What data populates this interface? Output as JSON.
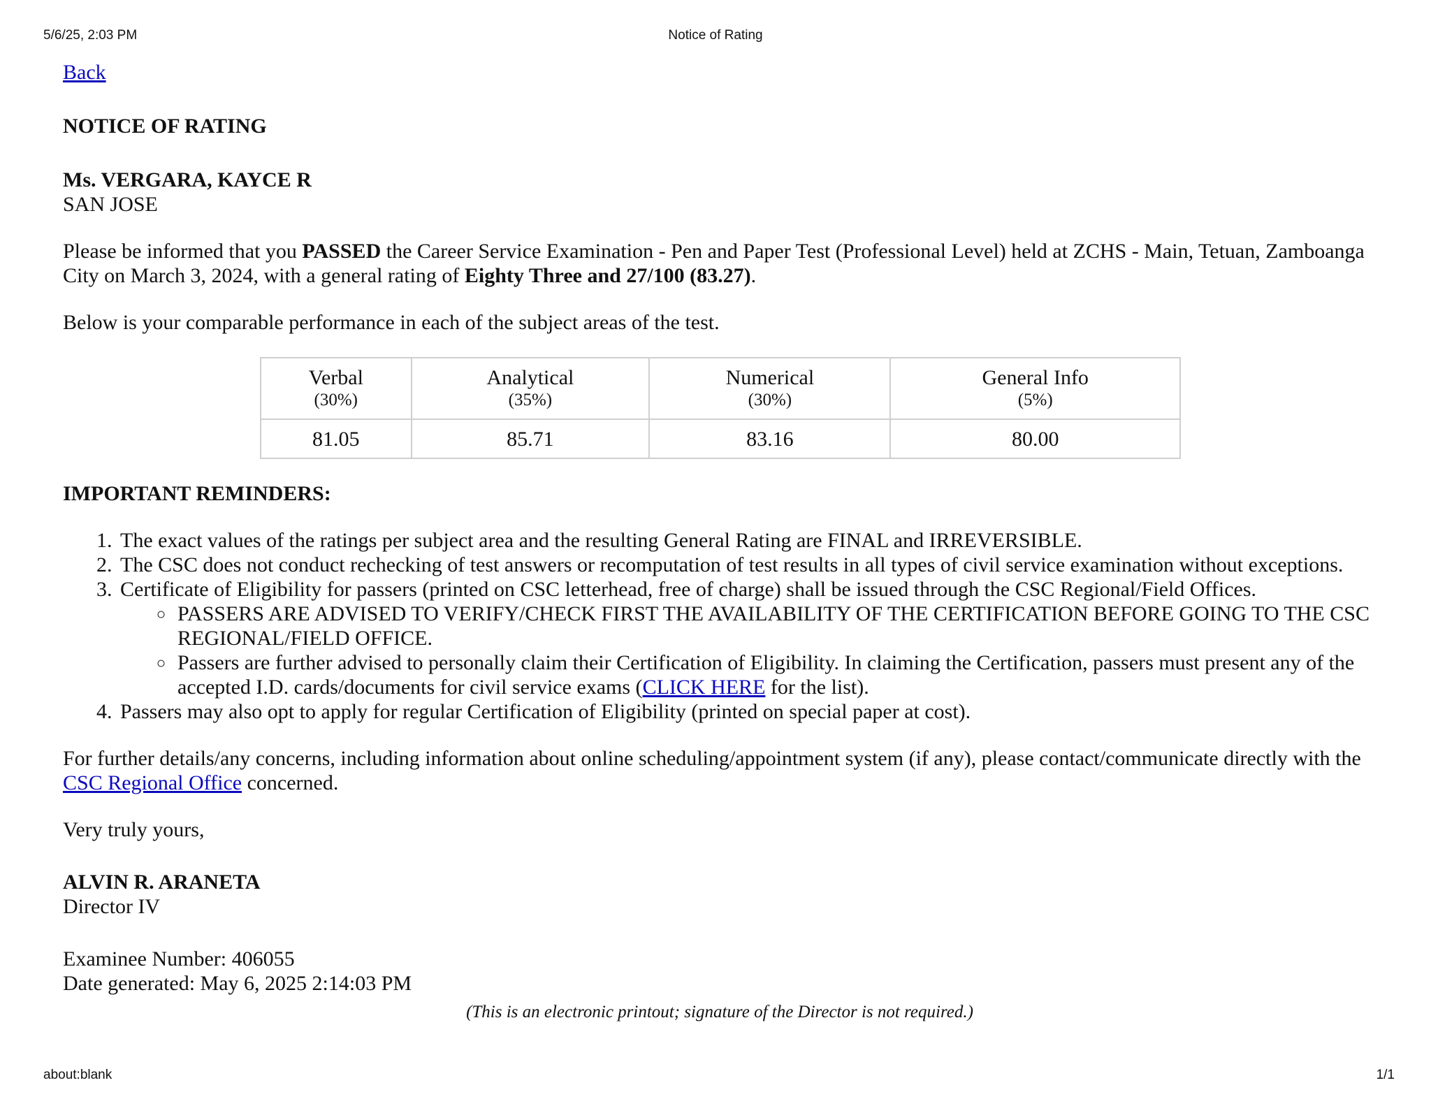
{
  "print_header": {
    "datetime": "5/6/25, 2:03 PM",
    "title": "Notice of Rating"
  },
  "print_footer": {
    "url": "about:blank",
    "page": "1/1"
  },
  "back_link": "Back",
  "heading": "NOTICE OF RATING",
  "examinee": {
    "name": "Ms. VERGARA, KAYCE R",
    "location": "SAN JOSE"
  },
  "intro": {
    "part1": "Please be informed that you ",
    "status": "PASSED",
    "part2": " the Career Service Examination - Pen and Paper Test (Professional Level) held at ZCHS - Main, Tetuan, Zamboanga City on March 3, 2024, with a general rating of ",
    "rating": "Eighty Three and 27/100 (83.27)",
    "part3": "."
  },
  "performance_intro": "Below is your comparable performance in each of the subject areas of the test.",
  "scores": {
    "headers": [
      {
        "subject": "Verbal",
        "weight": "(30%)"
      },
      {
        "subject": "Analytical",
        "weight": "(35%)"
      },
      {
        "subject": "Numerical",
        "weight": "(30%)"
      },
      {
        "subject": "General Info",
        "weight": "(5%)"
      }
    ],
    "values": [
      "81.05",
      "85.71",
      "83.16",
      "80.00"
    ]
  },
  "reminders": {
    "title": "IMPORTANT REMINDERS:",
    "item1": "The exact values of the ratings per subject area and the resulting General Rating are FINAL and IRREVERSIBLE.",
    "item2": "The CSC does not conduct rechecking of test answers or recomputation of test results in all types of civil service examination without exceptions.",
    "item3": "Certificate of Eligibility for passers (printed on CSC letterhead, free of charge) shall be issued through the CSC Regional/Field Offices.",
    "sub1": "PASSERS ARE ADVISED TO VERIFY/CHECK FIRST THE AVAILABILITY OF THE CERTIFICATION BEFORE GOING TO THE CSC REGIONAL/FIELD OFFICE.",
    "sub2_part1": "Passers are further advised to personally claim their Certification of Eligibility.  In claiming the Certification, passers must present any of the accepted I.D. cards/documents for civil service exams (",
    "sub2_link": "CLICK HERE",
    "sub2_part2": " for the list).",
    "item4": "Passers may also opt to apply for regular Certification of Eligibility (printed on special paper at cost)."
  },
  "contact": {
    "part1": "For further details/any concerns, including information about online scheduling/appointment system (if any), please contact/communicate directly with the ",
    "link": "CSC Regional Office",
    "part2": " concerned."
  },
  "closing": "Very truly yours,",
  "signer": {
    "name": "ALVIN R. ARANETA",
    "position": "Director IV"
  },
  "examinee_number": "Examinee Number:  406055",
  "date_generated": "Date generated: May 6, 2025 2:14:03 PM",
  "note": "(This is an electronic printout; signature of the Director is not required.)"
}
